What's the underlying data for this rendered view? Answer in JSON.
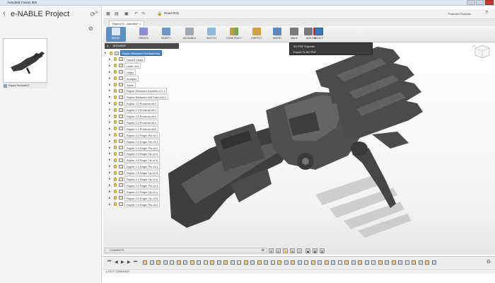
{
  "window": {
    "title": "Autodesk Fusion 360"
  },
  "data_panel": {
    "project_title": "e-NABLE Project",
    "item_caption": "Raptor Reloaded 2"
  },
  "app_toolbar": {
    "active_label": "Read Only",
    "user": "Prashant Dhawale"
  },
  "document": {
    "tab_label": "Raptor R....ssembly*"
  },
  "ribbon": {
    "workspace": "MODEL",
    "groups": [
      "CREATE",
      "MODIFY",
      "ASSEMBLE",
      "SKETCH",
      "CONSTRUCT",
      "INSPECT",
      "INSERT",
      "MAKE",
      "ADD-INS",
      "SELECT"
    ]
  },
  "dropdown": {
    "items": [
      "3D PDF Exporter",
      "Export To 3D PDF"
    ]
  },
  "browser": {
    "header": "BROWSER",
    "items": [
      {
        "label": "Raptor Reloaded Full Assembly",
        "root": true
      },
      {
        "label": "Named Views"
      },
      {
        "label": "Units: mm"
      },
      {
        "label": "Origin"
      },
      {
        "label": "Analysis"
      },
      {
        "label": "Joints"
      },
      {
        "label": "Raptor Reloaded Gauntlet v17:1"
      },
      {
        "label": "Raptor Reloaded Left Palm v24:1"
      },
      {
        "label": "Raptor 2.0 Proximal v8:1"
      },
      {
        "label": "Raptor 2.0 Proximal v8:2"
      },
      {
        "label": "Raptor 2.0 Proximal v8:3"
      },
      {
        "label": "Raptor 2.0 Proximal v8:4"
      },
      {
        "label": "Raptor 2.0 Proximal v8:5"
      },
      {
        "label": "Raptor 2.0 Finger Pin v3:1"
      },
      {
        "label": "Raptor 2.0 Finger Pin v3:1"
      },
      {
        "label": "Raptor 2.0 Finger Pin v3:2"
      },
      {
        "label": "Raptor 2.0 Finger Tip v3:2"
      },
      {
        "label": "Raptor 2.0 Finger Tip v2:5"
      },
      {
        "label": "Raptor 2.0 Finger Pin v3:3"
      },
      {
        "label": "Raptor 2.0 Finger Tip v2:3"
      },
      {
        "label": "Raptor 2.0 Finger Tip v2:4"
      },
      {
        "label": "Raptor 2.0 Finger Pin v3:4"
      },
      {
        "label": "Raptor 2.0 Finger Tip v2:4"
      },
      {
        "label": "Raptor 2.0 Finger Tip v3:5"
      },
      {
        "label": "Raptor 2.0 Finger Pin v3:5"
      }
    ]
  },
  "bottom": {
    "comments_label": "COMMENTS",
    "text_commands": "TEXT COMMANDS"
  }
}
